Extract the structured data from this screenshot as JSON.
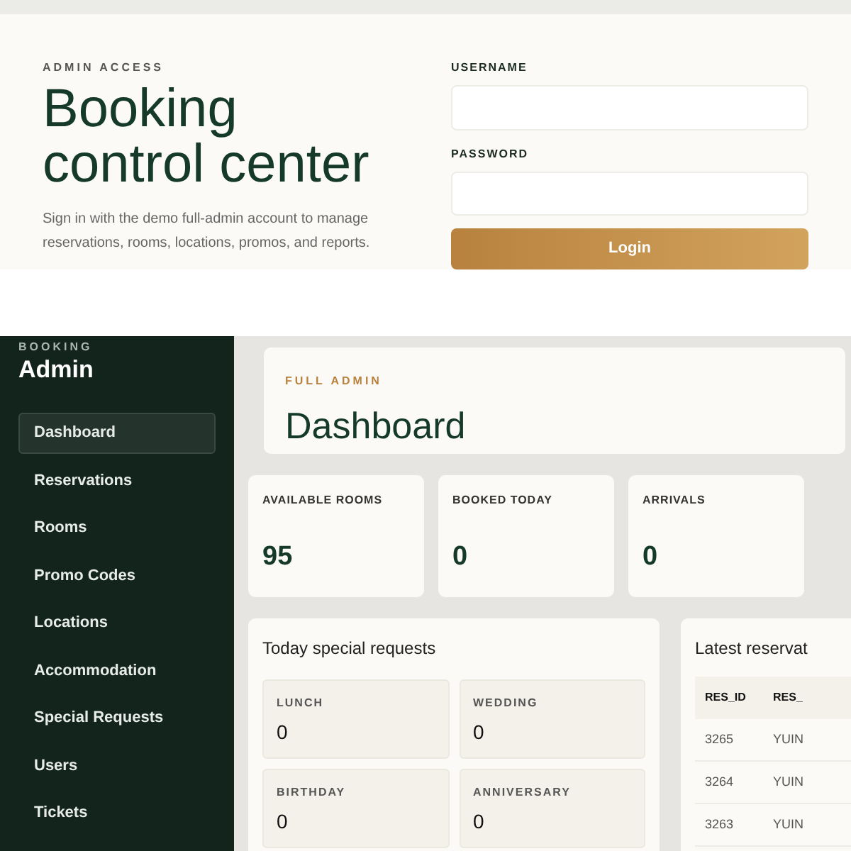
{
  "login": {
    "eyebrow": "ADMIN ACCESS",
    "title": "Booking control center",
    "description": "Sign in with the demo full-admin account to manage reservations, rooms, locations, promos, and reports.",
    "username_label": "USERNAME",
    "password_label": "PASSWORD",
    "login_button": "Login"
  },
  "sidebar": {
    "eyebrow": "BOOKING",
    "title": "Admin",
    "items": [
      {
        "label": "Dashboard",
        "selected": true
      },
      {
        "label": "Reservations",
        "selected": false
      },
      {
        "label": "Rooms",
        "selected": false
      },
      {
        "label": "Promo Codes",
        "selected": false
      },
      {
        "label": "Locations",
        "selected": false
      },
      {
        "label": "Accommodation",
        "selected": false
      },
      {
        "label": "Special Requests",
        "selected": false
      },
      {
        "label": "Users",
        "selected": false
      },
      {
        "label": "Tickets",
        "selected": false
      }
    ]
  },
  "header": {
    "eyebrow": "FULL ADMIN",
    "title": "Dashboard"
  },
  "stats": [
    {
      "label": "AVAILABLE ROOMS",
      "value": "95"
    },
    {
      "label": "BOOKED TODAY",
      "value": "0"
    },
    {
      "label": "ARRIVALS",
      "value": "0"
    }
  ],
  "special_requests": {
    "title": "Today special requests",
    "items": [
      {
        "label": "LUNCH",
        "value": "0"
      },
      {
        "label": "WEDDING",
        "value": "0"
      },
      {
        "label": "BIRTHDAY",
        "value": "0"
      },
      {
        "label": "ANNIVERSARY",
        "value": "0"
      }
    ]
  },
  "latest_reservations": {
    "title": "Latest reservat",
    "columns": [
      "RES_ID",
      "RES_"
    ],
    "rows": [
      [
        "3265",
        "YUIN"
      ],
      [
        "3264",
        "YUIN"
      ],
      [
        "3263",
        "YUIN"
      ]
    ]
  }
}
